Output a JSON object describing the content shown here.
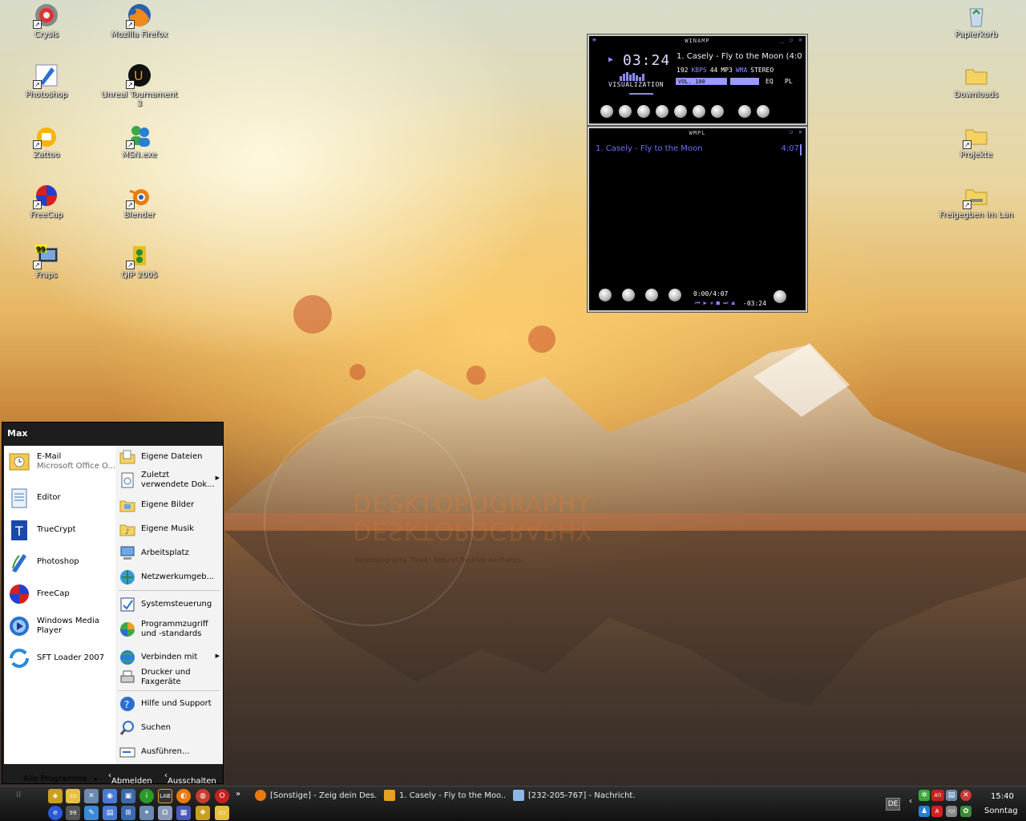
{
  "desktop": {
    "icons_left": [
      {
        "label": "Crysis",
        "icon": "crysis-icon"
      },
      {
        "label": "Mozilla Firefox",
        "icon": "firefox-icon"
      },
      {
        "label": "Photoshop",
        "icon": "photoshop-icon"
      },
      {
        "label": "Unreal Tournament 3",
        "icon": "unreal-icon"
      },
      {
        "label": "Zattoo",
        "icon": "zattoo-icon"
      },
      {
        "label": "MSN.exe",
        "icon": "msn-icon"
      },
      {
        "label": "FreeCap",
        "icon": "freecap-icon"
      },
      {
        "label": "Blender",
        "icon": "blender-icon"
      },
      {
        "label": "Fraps",
        "icon": "fraps-icon"
      },
      {
        "label": "QIP 2005",
        "icon": "qip-icon"
      }
    ],
    "icons_right": [
      {
        "label": "Papierkorb",
        "icon": "recycle-bin-icon"
      },
      {
        "label": "Downloads",
        "icon": "folder-icon"
      },
      {
        "label": "Projekte",
        "icon": "folder-icon"
      },
      {
        "label": "Freigegben im Lan",
        "icon": "shared-folder-icon"
      }
    ],
    "wallpaper_title": "DESKTOPOGRAPHY",
    "wallpaper_sup": "3",
    "wallpaper_sub": "Desktopography Three \\ Natural Desktop Aesthetics"
  },
  "winamp": {
    "title": "WINAMP",
    "time": "03:24",
    "track": "1. Casely - Fly to the Moon (4:07)",
    "kbps": "192",
    "kbps_label": "KBPS",
    "khz": "44",
    "mp3": "MP3",
    "wma": "WMA",
    "stereo": "STEREO",
    "vis_label": "VISUALIZATION",
    "vol_label": "VOL. 100",
    "eq": "EQ",
    "pl": "PL",
    "volume": 1.0
  },
  "playlist": {
    "title": "WMPL",
    "items": [
      {
        "name": "1. Casely - Fly to the Moon",
        "length": "4:07"
      }
    ],
    "position": "0:00/4:07",
    "remaining": "-03:24"
  },
  "start_menu": {
    "user": "Max",
    "pinned": [
      {
        "title": "E-Mail",
        "subtitle": "Microsoft Office O...",
        "icon": "outlook-icon"
      },
      {
        "title": "Editor",
        "subtitle": "",
        "icon": "notepad-icon"
      },
      {
        "title": "TrueCrypt",
        "subtitle": "",
        "icon": "truecrypt-icon"
      },
      {
        "title": "Photoshop",
        "subtitle": "",
        "icon": "photoshop-icon"
      },
      {
        "title": "FreeCap",
        "subtitle": "",
        "icon": "freecap-icon"
      },
      {
        "title": "Windows Media Player",
        "subtitle": "",
        "icon": "media-player-icon"
      },
      {
        "title": "SFT Loader 2007",
        "subtitle": "",
        "icon": "sft-loader-icon"
      }
    ],
    "all_programs": "Alle Programme",
    "places": [
      {
        "label": "Eigene Dateien",
        "icon": "documents-icon"
      },
      {
        "label": "Zuletzt verwendete Dok...",
        "icon": "recent-docs-icon"
      },
      {
        "label": "Eigene Bilder",
        "icon": "pictures-icon"
      },
      {
        "label": "Eigene Musik",
        "icon": "music-icon"
      },
      {
        "label": "Arbeitsplatz",
        "icon": "my-computer-icon"
      },
      {
        "label": "Netzwerkumgeb...",
        "icon": "network-icon"
      },
      {
        "label": "Systemsteuerung",
        "icon": "control-panel-icon"
      },
      {
        "label": "Programmzugriff und -standards",
        "icon": "program-access-icon"
      },
      {
        "label": "Verbinden mit",
        "icon": "connect-icon"
      },
      {
        "label": "Drucker und Faxgeräte",
        "icon": "printer-icon"
      },
      {
        "label": "Hilfe und Support",
        "icon": "help-icon"
      },
      {
        "label": "Suchen",
        "icon": "search-icon"
      },
      {
        "label": "Ausführen...",
        "icon": "run-icon"
      }
    ],
    "logoff": "Abmelden",
    "shutdown": "Ausschalten"
  },
  "taskbar": {
    "buttons": [
      {
        "label": "[Sonstige] - Zeig dein Des...",
        "icon": "firefox-icon"
      },
      {
        "label": "1. Casely - Fly to the Moo...",
        "icon": "winamp-icon"
      },
      {
        "label": "[232-205-767] - Nachricht...",
        "icon": "message-icon"
      }
    ],
    "language": "DE",
    "clock": "15:40",
    "day": "Sonntag",
    "overflow": "»"
  }
}
